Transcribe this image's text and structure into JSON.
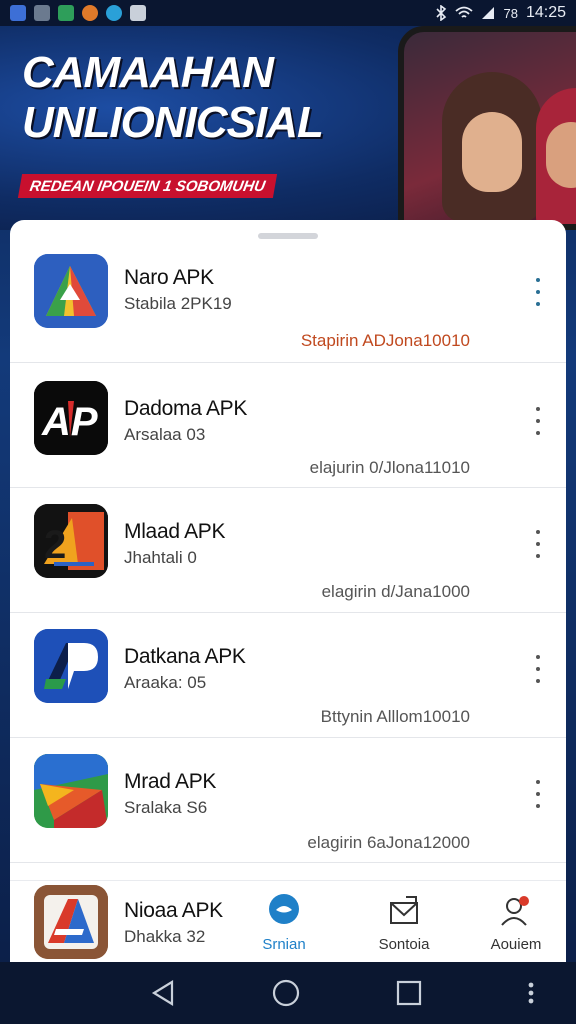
{
  "status_bar": {
    "battery": "78",
    "time": "14:25"
  },
  "banner": {
    "title_line1": "CAMAAHAN",
    "title_line2": "UNLIONICSIAL",
    "ribbon": "REDEAN IPOUEIN 1 SOBOMUHU"
  },
  "apps": [
    {
      "name": "Naro APK",
      "sub": "Stabila 2PK19",
      "meta": "Stapirin ADJona10010",
      "icon": "maps-triangle-icon"
    },
    {
      "name": "Dadoma APK",
      "sub": "Arsalaa 03",
      "meta": "elajurin 0/Jlona11010",
      "icon": "ap-logo-icon"
    },
    {
      "name": "Mlaad APK",
      "sub": "Jhahtali 0",
      "meta": "elagirin d/Jana1000",
      "icon": "2d-logo-icon"
    },
    {
      "name": "Datkana APK",
      "sub": "Araaka: 05",
      "meta": "Bttynin Alllom10010",
      "icon": "p-logo-icon"
    },
    {
      "name": "Mrad APK",
      "sub": "Sralaka S6",
      "meta": "elagirin 6aJona12000",
      "icon": "arrow-logo-icon"
    }
  ],
  "bottom_app": {
    "name": "Nioaa APK",
    "sub": "Dhakka 32",
    "icon": "a-logo-icon"
  },
  "nav": [
    {
      "label": "Srnian",
      "icon": "chat-bubble-icon"
    },
    {
      "label": "Sontoia",
      "icon": "mail-icon"
    },
    {
      "label": "Aouiem",
      "icon": "person-pin-icon"
    }
  ],
  "colors": {
    "accent_blue": "#1f80c8",
    "accent_orange": "#c0491f",
    "banner_red": "#c8102e"
  }
}
